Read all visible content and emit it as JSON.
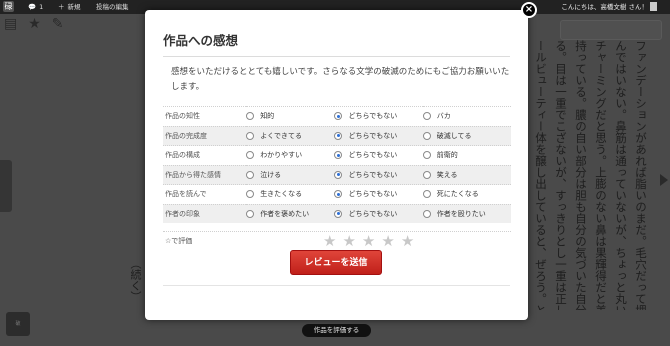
{
  "adminbar": {
    "logo": "碌",
    "comments_count": "1",
    "new_label": "新規",
    "edit_label": "投稿の編集",
    "greeting": "こんにちは、高橋文樹 さん！"
  },
  "reader": {
    "columns": [
      "ファンデーションがあれば脂いのまだ。毛穴だって埋",
      "んではいない。鼻筋は通っていないが、ちょっと丸い鼻は",
      "チャーミングだと思う。上膨のない鼻は果輝得だと美しさを",
      "持っている。膿の自い部分は胆も自分の気づいた自分をしてい",
      "る。目は一重でこざないが、すっきりとし一重は正しく",
      "ールビューティー体を醸し出していると、ぜろう。と言えなく"
    ],
    "left_vertical": "（続く）"
  },
  "modal": {
    "title": "作品への感想",
    "intro": "感想をいただけるととても嬉しいです。さらなる文学の破滅のためにもご協力お願いいたします。",
    "rows": [
      {
        "label": "作品の知性",
        "options": [
          "知的",
          "どちらでもない",
          "バカ"
        ]
      },
      {
        "label": "作品の完成度",
        "options": [
          "よくできてる",
          "どちらでもない",
          "破滅してる"
        ]
      },
      {
        "label": "作品の構成",
        "options": [
          "わかりやすい",
          "どちらでもない",
          "前衛的"
        ]
      },
      {
        "label": "作品から得た感情",
        "options": [
          "泣ける",
          "どちらでもない",
          "笑える"
        ]
      },
      {
        "label": "作品を読んで",
        "options": [
          "生きたくなる",
          "どちらでもない",
          "死にたくなる"
        ]
      },
      {
        "label": "作者の印象",
        "options": [
          "作者を褒めたい",
          "どちらでもない",
          "作者を殴りたい"
        ]
      }
    ],
    "stars_label": "☆で評価",
    "star_glyph": "★",
    "submit_label": "レビューを送信",
    "close_glyph": "×"
  },
  "eval_button": "作品を評価する",
  "colors": {
    "accent_red": "#c0201a",
    "radio_selected": "#2d6fd6"
  }
}
